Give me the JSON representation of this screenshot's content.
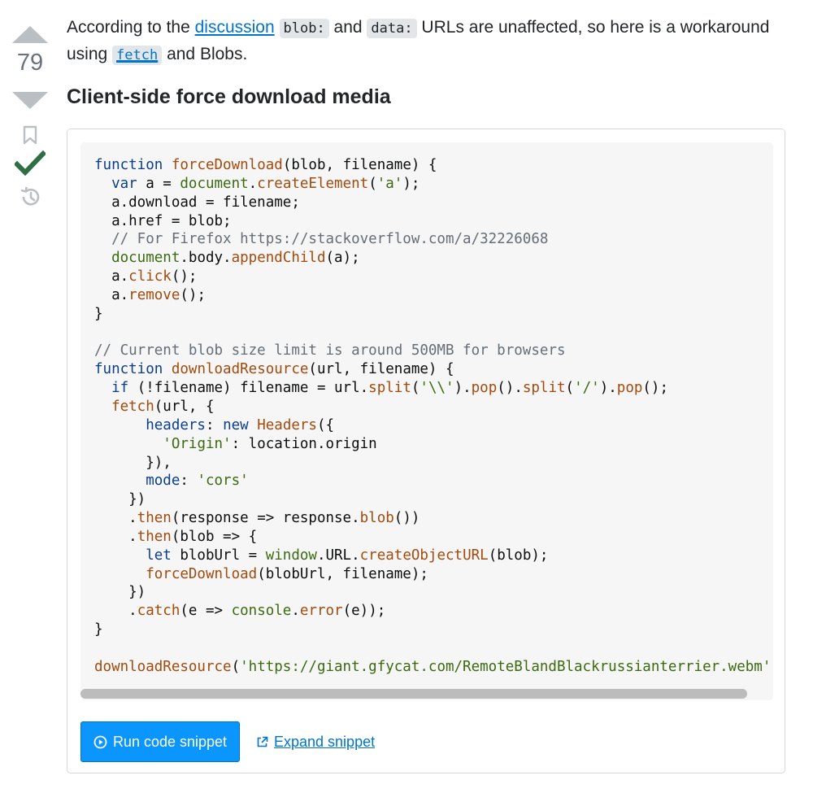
{
  "vote": {
    "score": "79",
    "icons": [
      "upvote-arrow",
      "downvote-arrow",
      "bookmark-icon",
      "accepted-check-icon",
      "history-icon"
    ]
  },
  "answer": {
    "intro": {
      "part1": "According to the ",
      "link_discussion": "discussion",
      "code_blob": "blob:",
      "and": " and ",
      "code_data": "data:",
      "part2": " URLs are unaffected, so here is a workaround using ",
      "link_fetch": "fetch",
      "part3": " and Blobs."
    },
    "heading": "Client-side force download media"
  },
  "snippet": {
    "code_lines": [
      [
        [
          "kw",
          "function"
        ],
        [
          "pl",
          " "
        ],
        [
          "fn",
          "forceDownload"
        ],
        [
          "pl",
          "(blob, filename) {"
        ]
      ],
      [
        [
          "pl",
          "  "
        ],
        [
          "kw",
          "var"
        ],
        [
          "pl",
          " a = "
        ],
        [
          "bi",
          "document"
        ],
        [
          "pl",
          "."
        ],
        [
          "fn",
          "createElement"
        ],
        [
          "pl",
          "("
        ],
        [
          "str",
          "'a'"
        ],
        [
          "pl",
          ");"
        ]
      ],
      [
        [
          "pl",
          "  a.download = filename;"
        ]
      ],
      [
        [
          "pl",
          "  a.href = blob;"
        ]
      ],
      [
        [
          "com",
          "  // For Firefox https://stackoverflow.com/a/32226068"
        ]
      ],
      [
        [
          "pl",
          "  "
        ],
        [
          "bi",
          "document"
        ],
        [
          "pl",
          ".body."
        ],
        [
          "fn",
          "appendChild"
        ],
        [
          "pl",
          "(a);"
        ]
      ],
      [
        [
          "pl",
          "  a."
        ],
        [
          "fn",
          "click"
        ],
        [
          "pl",
          "();"
        ]
      ],
      [
        [
          "pl",
          "  a."
        ],
        [
          "fn",
          "remove"
        ],
        [
          "pl",
          "();"
        ]
      ],
      [
        [
          "pl",
          "}"
        ]
      ],
      [
        [
          "pl",
          ""
        ]
      ],
      [
        [
          "com",
          "// Current blob size limit is around 500MB for browsers"
        ]
      ],
      [
        [
          "kw",
          "function"
        ],
        [
          "pl",
          " "
        ],
        [
          "fn",
          "downloadResource"
        ],
        [
          "pl",
          "(url, filename) {"
        ]
      ],
      [
        [
          "pl",
          "  "
        ],
        [
          "kw",
          "if"
        ],
        [
          "pl",
          " (!filename) filename = url."
        ],
        [
          "fn",
          "split"
        ],
        [
          "pl",
          "("
        ],
        [
          "str",
          "'\\\\'"
        ],
        [
          "pl",
          ")."
        ],
        [
          "fn",
          "pop"
        ],
        [
          "pl",
          "()."
        ],
        [
          "fn",
          "split"
        ],
        [
          "pl",
          "("
        ],
        [
          "str",
          "'/'"
        ],
        [
          "pl",
          ")."
        ],
        [
          "fn",
          "pop"
        ],
        [
          "pl",
          "();"
        ]
      ],
      [
        [
          "pl",
          "  "
        ],
        [
          "fn",
          "fetch"
        ],
        [
          "pl",
          "(url, {"
        ]
      ],
      [
        [
          "pl",
          "      "
        ],
        [
          "kw",
          "headers"
        ],
        [
          "pl",
          ": "
        ],
        [
          "kw",
          "new"
        ],
        [
          "pl",
          " "
        ],
        [
          "fn",
          "Headers"
        ],
        [
          "pl",
          "({"
        ]
      ],
      [
        [
          "pl",
          "        "
        ],
        [
          "str",
          "'Origin'"
        ],
        [
          "pl",
          ": location.origin"
        ]
      ],
      [
        [
          "pl",
          "      }),"
        ]
      ],
      [
        [
          "pl",
          "      "
        ],
        [
          "kw",
          "mode"
        ],
        [
          "pl",
          ": "
        ],
        [
          "str",
          "'cors'"
        ]
      ],
      [
        [
          "pl",
          "    })"
        ]
      ],
      [
        [
          "pl",
          "    ."
        ],
        [
          "fn",
          "then"
        ],
        [
          "pl",
          "(response => response."
        ],
        [
          "fn",
          "blob"
        ],
        [
          "pl",
          "())"
        ]
      ],
      [
        [
          "pl",
          "    ."
        ],
        [
          "fn",
          "then"
        ],
        [
          "pl",
          "(blob => {"
        ]
      ],
      [
        [
          "pl",
          "      "
        ],
        [
          "kw",
          "let"
        ],
        [
          "pl",
          " blobUrl = "
        ],
        [
          "bi",
          "window"
        ],
        [
          "pl",
          ".URL."
        ],
        [
          "fn",
          "createObjectURL"
        ],
        [
          "pl",
          "(blob);"
        ]
      ],
      [
        [
          "pl",
          "      "
        ],
        [
          "fn",
          "forceDownload"
        ],
        [
          "pl",
          "(blobUrl, filename);"
        ]
      ],
      [
        [
          "pl",
          "    })"
        ]
      ],
      [
        [
          "pl",
          "    ."
        ],
        [
          "fn",
          "catch"
        ],
        [
          "pl",
          "(e => "
        ],
        [
          "bi",
          "console"
        ],
        [
          "pl",
          "."
        ],
        [
          "fn",
          "error"
        ],
        [
          "pl",
          "(e));"
        ]
      ],
      [
        [
          "pl",
          "}"
        ]
      ],
      [
        [
          "pl",
          ""
        ]
      ],
      [
        [
          "fn",
          "downloadResource"
        ],
        [
          "pl",
          "("
        ],
        [
          "str",
          "'https://giant.gfycat.com/RemoteBlandBlackrussianterrier.webm'"
        ],
        [
          "pl",
          ");"
        ]
      ]
    ],
    "run_label": "Run code snippet",
    "expand_label": "Expand snippet",
    "colors": {
      "keyword": "#0b3e8a",
      "function": "#a34a0c",
      "builtin_string": "#3b6a10",
      "comment": "#656e77",
      "run_button_bg": "#0a95ff"
    }
  }
}
